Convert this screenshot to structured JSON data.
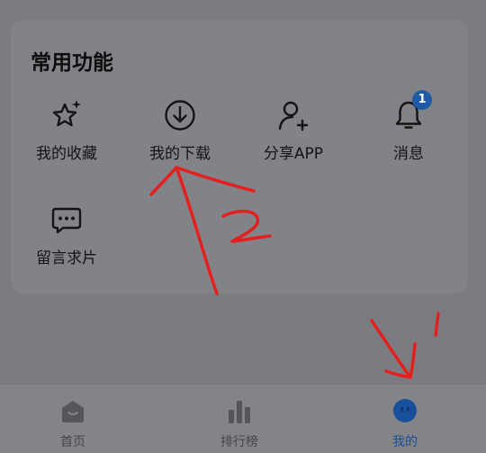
{
  "section": {
    "title": "常用功能",
    "features": [
      {
        "label": "我的收藏",
        "icon": "star-sparkle-icon"
      },
      {
        "label": "我的下载",
        "icon": "download-icon"
      },
      {
        "label": "分享APP",
        "icon": "add-user-icon"
      },
      {
        "label": "消息",
        "icon": "bell-icon",
        "badge": "1"
      },
      {
        "label": "留言求片",
        "icon": "chat-bubble-icon"
      }
    ]
  },
  "tabbar": {
    "tabs": [
      {
        "label": "首页",
        "icon": "home-icon"
      },
      {
        "label": "排行榜",
        "icon": "bar-chart-icon"
      },
      {
        "label": "我的",
        "icon": "profile-icon",
        "active": true
      }
    ]
  },
  "colors": {
    "badge": "#1e5aa8",
    "active_tab": "#1a4f9c",
    "annotation_ink": "#e3201d"
  }
}
